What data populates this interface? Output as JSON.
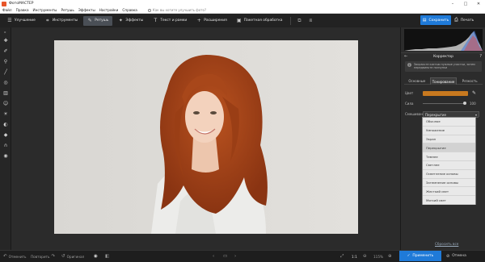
{
  "window": {
    "title": "ФотоМАСТЕР",
    "controls": [
      "–",
      "□",
      "✕"
    ]
  },
  "menu": {
    "items": [
      "Файл",
      "Правка",
      "Инструменты",
      "Ретушь",
      "Эффекты",
      "Настройки",
      "Справка"
    ],
    "search_placeholder": "Как вы хотите улучшить фото?"
  },
  "toolbar": {
    "tabs": [
      {
        "label": "Улучшение",
        "icon": "sliders-icon"
      },
      {
        "label": "Инструменты",
        "icon": "crop-icon"
      },
      {
        "label": "Ретушь",
        "icon": "brush-icon",
        "active": true
      },
      {
        "label": "Эффекты",
        "icon": "sparkle-icon"
      },
      {
        "label": "Текст и рамки",
        "icon": "text-icon"
      },
      {
        "label": "Расширения",
        "icon": "plus-icon"
      },
      {
        "label": "Пакетная обработка",
        "icon": "batch-icon"
      }
    ],
    "save_label": "Сохранить",
    "print_label": "Печать"
  },
  "panel": {
    "title": "Корректор",
    "tip": "Закрасьте кистью нужные участки, затем передвиньте ползунки",
    "tabs": [
      "Основные",
      "Тонирование",
      "Резкость"
    ],
    "active_tab": "Тонирование",
    "color_label": "Цвет",
    "color_value": "#c8791f",
    "strength_label": "Сила",
    "strength_value": "100",
    "strength_fraction": 1.0,
    "blend_label": "Смешивание",
    "blend_value": "Перекрытие",
    "blend_options": [
      "Обычное",
      "Умножение",
      "Экран",
      "Перекрытие",
      "Темнее",
      "Светлее",
      "Осветление основы",
      "Затемнение основы",
      "Жесткий свет",
      "Мягкий свет"
    ],
    "blend_selected": "Перекрытие",
    "reset_label": "Сбросить все"
  },
  "bottombar": {
    "undo_label": "Отменить",
    "redo_label": "Повторить",
    "original_label": "Оригинал",
    "ratio_label": "1:1",
    "zoom_label": "115%",
    "apply_label": "Применить",
    "cancel_label": "Отмена"
  }
}
